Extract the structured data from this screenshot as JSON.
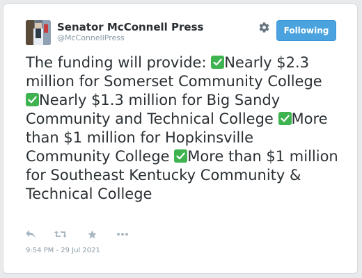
{
  "account": {
    "name": "Senator McConnell Press",
    "handle": "@McConnellPress"
  },
  "follow_button": {
    "label": "Following"
  },
  "tweet": {
    "segments": [
      "The funding will provide: ",
      "Nearly $2.3 million for Somerset Community College ",
      "Nearly $1.3 million for Big Sandy Community and Technical College ",
      "More than $1 million for Hopkinsville Community College ",
      "More than $1 million for Southeast Kentucky Community & Technical College"
    ]
  },
  "timestamp": "9:54 PM - 29 Jul 2021",
  "icons": {
    "settings": "gear-icon",
    "reply": "reply-icon",
    "retweet": "retweet-icon",
    "favorite": "star-icon",
    "more": "more-icon",
    "checkmark": "check-mark-emoji-icon"
  },
  "colors": {
    "button": "#4aa3df",
    "checkmark": "#3fb34f",
    "text": "#292f33",
    "muted": "#8899a6"
  }
}
